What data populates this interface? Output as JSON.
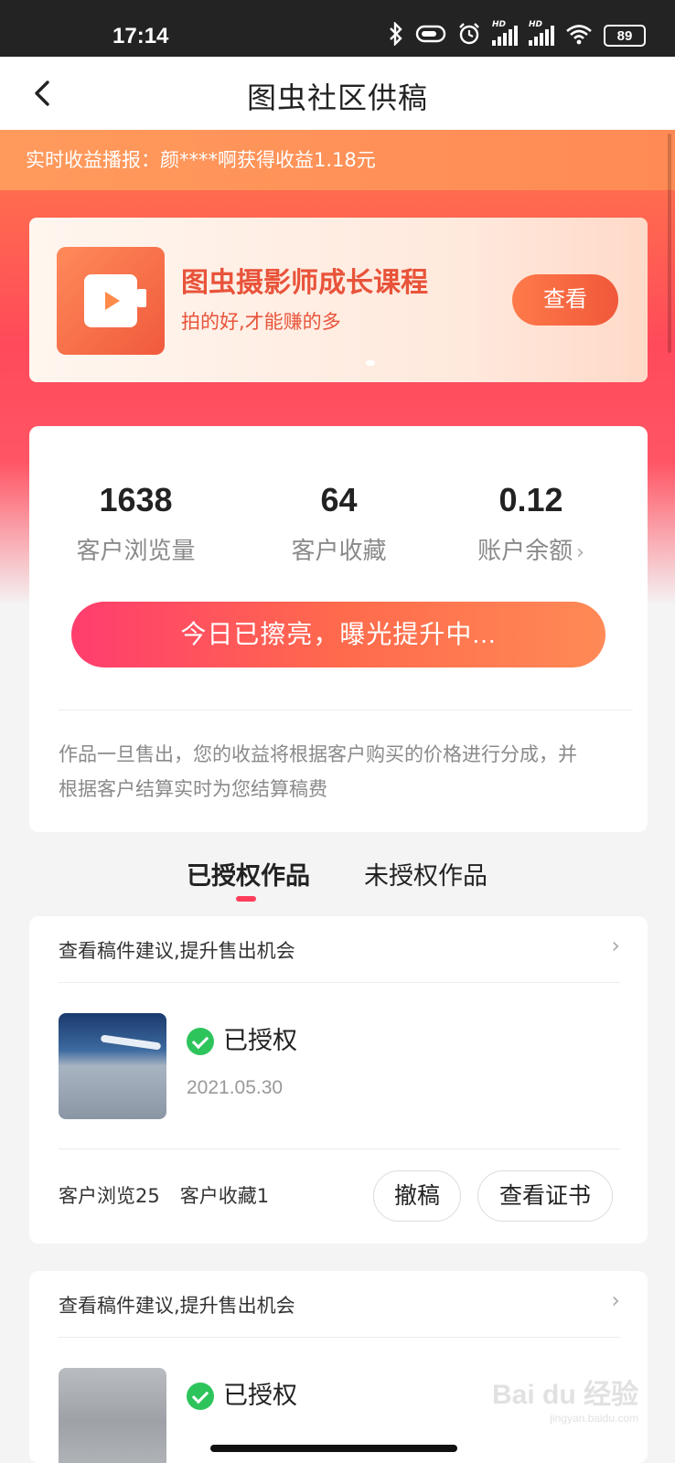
{
  "status_bar": {
    "time": "17:14",
    "battery": "89",
    "hd_label": "HD"
  },
  "nav": {
    "title": "图虫社区供稿"
  },
  "ticker": {
    "text": "实时收益播报：颜****啊获得收益1.18元"
  },
  "banner": {
    "title": "图虫摄影师成长课程",
    "subtitle": "拍的好,才能赚的多",
    "button": "查看"
  },
  "stats": {
    "items": [
      {
        "value": "1638",
        "label": "客户浏览量"
      },
      {
        "value": "64",
        "label": "客户收藏"
      },
      {
        "value": "0.12",
        "label": "账户余额"
      }
    ],
    "boost_button": "今日已擦亮，曝光提升中...",
    "note": "作品一旦售出，您的收益将根据客户购买的价格进行分成，并根据客户结算实时为您结算稿费"
  },
  "tabs": [
    {
      "label": "已授权作品",
      "active": true
    },
    {
      "label": "未授权作品",
      "active": false
    }
  ],
  "works": [
    {
      "tip": "查看稿件建议,提升售出机会",
      "status": "已授权",
      "date": "2021.05.30",
      "views": "客户浏览25",
      "favorites": "客户收藏1",
      "withdraw": "撤稿",
      "certificate": "查看证书"
    },
    {
      "tip": "查看稿件建议,提升售出机会",
      "status": "已授权"
    }
  ],
  "watermark": {
    "text": "Bai du 经验",
    "sub": "jingyan.baidu.com"
  },
  "colors": {
    "accent": "#ff3d5a",
    "banner_text": "#e8533a",
    "check_green": "#2ec45c"
  }
}
